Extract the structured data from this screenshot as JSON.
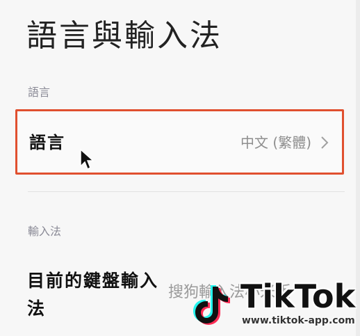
{
  "page": {
    "title": "語言與輸入法"
  },
  "language_section": {
    "header": "語言",
    "row_label": "語言",
    "row_value": "中文 (繁體)"
  },
  "input_method_section": {
    "header": "輸入法",
    "row_label": "目前的鍵盤輸入法",
    "row_value": "搜狗輸入法小米版"
  },
  "watermark": {
    "brand": "TikTok",
    "url": "www.tiktok-app.com"
  },
  "colors": {
    "highlight_border": "#e0502f",
    "section_header": "#8a8a96",
    "value_text": "#8e8e8e"
  },
  "icons": {
    "chevron": "chevron-right-icon",
    "cursor": "mouse-pointer-icon",
    "logo": "tiktok-logo-icon"
  }
}
